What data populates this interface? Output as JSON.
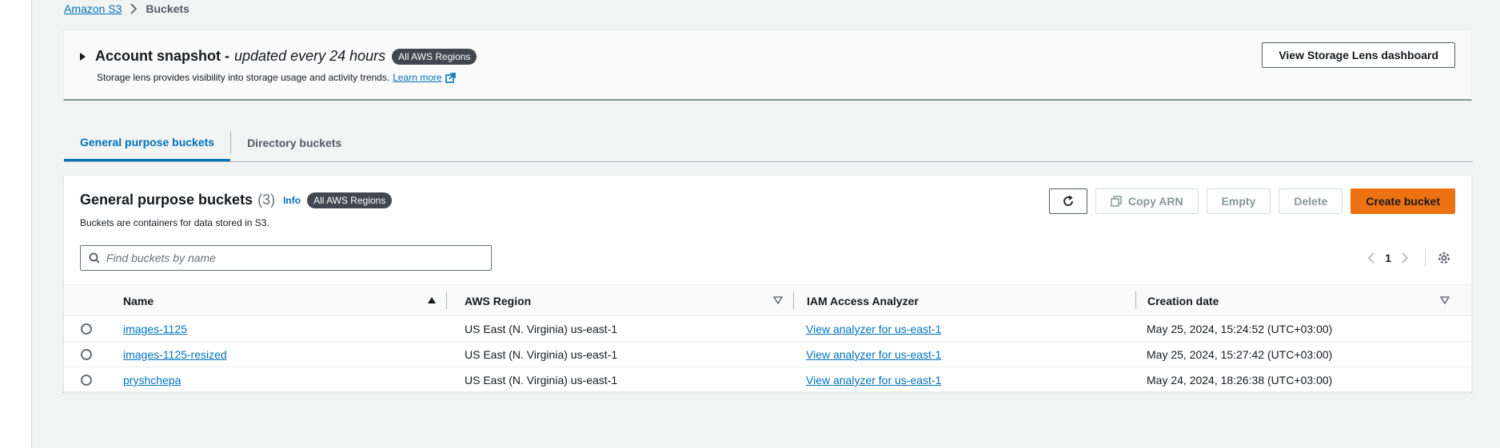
{
  "breadcrumb": {
    "root": "Amazon S3",
    "current": "Buckets"
  },
  "snapshot": {
    "title": "Account snapshot -",
    "subtitle": "updated every 24 hours",
    "badge": "All AWS Regions",
    "description": "Storage lens provides visibility into storage usage and activity trends.",
    "learn_more": "Learn more",
    "dashboard_button": "View Storage Lens dashboard"
  },
  "tabs": [
    "General purpose buckets",
    "Directory buckets"
  ],
  "panel": {
    "title": "General purpose buckets",
    "count": "(3)",
    "info": "Info",
    "badge": "All AWS Regions",
    "description": "Buckets are containers for data stored in S3.",
    "actions": {
      "copy_arn": "Copy ARN",
      "empty": "Empty",
      "delete": "Delete",
      "create": "Create bucket"
    },
    "search_placeholder": "Find buckets by name",
    "page": "1"
  },
  "table": {
    "columns": [
      "Name",
      "AWS Region",
      "IAM Access Analyzer",
      "Creation date"
    ],
    "rows": [
      {
        "name": "images-1125",
        "region": "US East (N. Virginia) us-east-1",
        "analyzer": "View analyzer for us-east-1",
        "date": "May 25, 2024, 15:24:52 (UTC+03:00)"
      },
      {
        "name": "images-1125-resized",
        "region": "US East (N. Virginia) us-east-1",
        "analyzer": "View analyzer for us-east-1",
        "date": "May 25, 2024, 15:27:42 (UTC+03:00)"
      },
      {
        "name": "pryshchepa",
        "region": "US East (N. Virginia) us-east-1",
        "analyzer": "View analyzer for us-east-1",
        "date": "May 24, 2024, 18:26:38 (UTC+03:00)"
      }
    ]
  },
  "colors": {
    "link": "#0073bb",
    "primary": "#ec7211",
    "badge": "#414750"
  },
  "icons": [
    "chevron-right-icon",
    "caret-right-icon",
    "external-link-icon",
    "refresh-icon",
    "copy-icon",
    "search-icon",
    "chevron-left-icon",
    "settings-gear-icon",
    "sort-ascending-icon",
    "sort-descending-icon"
  ]
}
